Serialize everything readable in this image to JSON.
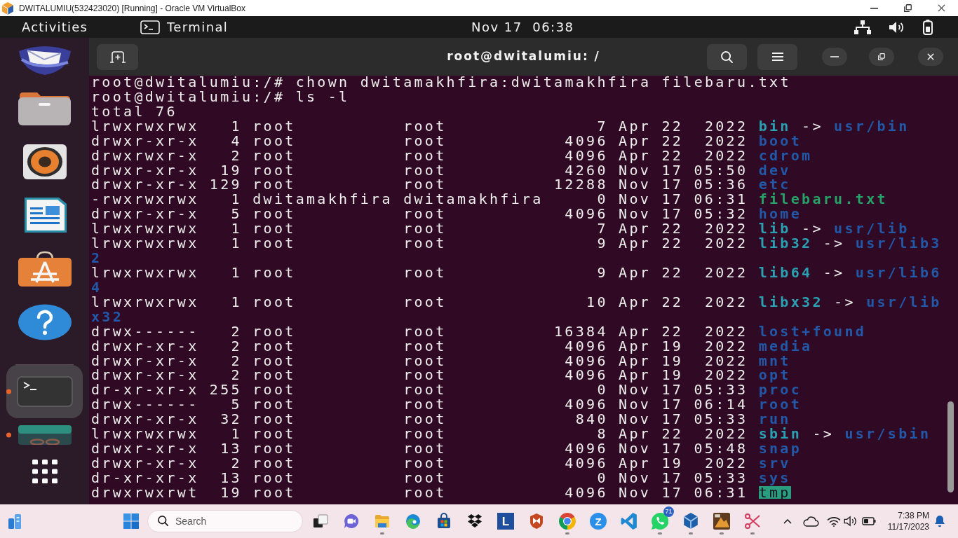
{
  "vm_window": {
    "title": "DWITALUMIU(532423020) [Running] - Oracle VM VirtualBox"
  },
  "top_bar": {
    "activities": "Activities",
    "app_menu": "Terminal",
    "clock": "Nov 17  06:38"
  },
  "dock": {
    "pinned": [
      {
        "kind": "mail",
        "selected": false,
        "running": false
      },
      {
        "kind": "files",
        "selected": false,
        "running": false
      },
      {
        "kind": "music",
        "selected": false,
        "running": false
      },
      {
        "kind": "writer",
        "selected": false,
        "running": false
      },
      {
        "kind": "store",
        "selected": false,
        "running": false
      },
      {
        "kind": "help",
        "selected": false,
        "running": false
      }
    ],
    "others": [
      {
        "kind": "terminal",
        "selected": true,
        "running": true
      },
      {
        "kind": "tile",
        "selected": false,
        "running": true
      }
    ]
  },
  "terminal": {
    "title": "root@dwitalumiu: /",
    "lines": [
      {
        "kind": "command",
        "prompt": "root@dwitalumiu:/#",
        "command": "chown dwitamakhfira:dwitamakhfira filebaru.txt"
      },
      {
        "kind": "command",
        "prompt": "root@dwitalumiu:/#",
        "command": "ls -l"
      },
      {
        "kind": "output",
        "text": "total 76"
      },
      {
        "kind": "entry",
        "mode": "lrwxrwxrwx",
        "links": "1",
        "owner": "root",
        "group": "root",
        "size": "7",
        "month": "Apr",
        "day": "22",
        "time": "2022",
        "name": {
          "text": "bin",
          "kind": "symlink"
        },
        "arrow": "->",
        "target": {
          "text": "usr/bin",
          "kind": "directory"
        }
      },
      {
        "kind": "entry",
        "mode": "drwxr-xr-x",
        "links": "4",
        "owner": "root",
        "group": "root",
        "size": "4096",
        "month": "Apr",
        "day": "22",
        "time": "2022",
        "name": {
          "text": "boot",
          "kind": "directory"
        }
      },
      {
        "kind": "entry",
        "mode": "drwxrwxr-x",
        "links": "2",
        "owner": "root",
        "group": "root",
        "size": "4096",
        "month": "Apr",
        "day": "22",
        "time": "2022",
        "name": {
          "text": "cdrom",
          "kind": "directory"
        }
      },
      {
        "kind": "entry",
        "mode": "drwxr-xr-x",
        "links": "19",
        "owner": "root",
        "group": "root",
        "size": "4260",
        "month": "Nov",
        "day": "17",
        "time": "05:50",
        "name": {
          "text": "dev",
          "kind": "directory"
        }
      },
      {
        "kind": "entry",
        "mode": "drwxr-xr-x",
        "links": "129",
        "owner": "root",
        "group": "root",
        "size": "12288",
        "month": "Nov",
        "day": "17",
        "time": "05:36",
        "name": {
          "text": "etc",
          "kind": "directory"
        }
      },
      {
        "kind": "entry",
        "mode": "-rwxrwxrwx",
        "links": "1",
        "owner": "dwitamakhfira",
        "group": "dwitamakhfira",
        "size": "0",
        "month": "Nov",
        "day": "17",
        "time": "06:31",
        "name": {
          "text": "filebaru.txt",
          "kind": "executable"
        }
      },
      {
        "kind": "entry",
        "mode": "drwxr-xr-x",
        "links": "5",
        "owner": "root",
        "group": "root",
        "size": "4096",
        "month": "Nov",
        "day": "17",
        "time": "05:32",
        "name": {
          "text": "home",
          "kind": "directory"
        }
      },
      {
        "kind": "entry",
        "mode": "lrwxrwxrwx",
        "links": "1",
        "owner": "root",
        "group": "root",
        "size": "7",
        "month": "Apr",
        "day": "22",
        "time": "2022",
        "name": {
          "text": "lib",
          "kind": "symlink"
        },
        "arrow": "->",
        "target": {
          "text": "usr/lib",
          "kind": "directory"
        }
      },
      {
        "kind": "entry",
        "mode": "lrwxrwxrwx",
        "links": "1",
        "owner": "root",
        "group": "root",
        "size": "9",
        "month": "Apr",
        "day": "22",
        "time": "2022",
        "name": {
          "text": "lib32",
          "kind": "symlink"
        },
        "arrow": "->",
        "target": {
          "text": "usr/lib3",
          "kind": "directory"
        }
      },
      {
        "kind": "wrap",
        "segment": {
          "text": "2",
          "kind": "directory"
        }
      },
      {
        "kind": "entry",
        "mode": "lrwxrwxrwx",
        "links": "1",
        "owner": "root",
        "group": "root",
        "size": "9",
        "month": "Apr",
        "day": "22",
        "time": "2022",
        "name": {
          "text": "lib64",
          "kind": "symlink"
        },
        "arrow": "->",
        "target": {
          "text": "usr/lib6",
          "kind": "directory"
        }
      },
      {
        "kind": "wrap",
        "segment": {
          "text": "4",
          "kind": "directory"
        }
      },
      {
        "kind": "entry",
        "mode": "lrwxrwxrwx",
        "links": "1",
        "owner": "root",
        "group": "root",
        "size": "10",
        "month": "Apr",
        "day": "22",
        "time": "2022",
        "name": {
          "text": "libx32",
          "kind": "symlink"
        },
        "arrow": "->",
        "target": {
          "text": "usr/lib",
          "kind": "directory"
        }
      },
      {
        "kind": "wrap",
        "segment": {
          "text": "x32",
          "kind": "directory"
        }
      },
      {
        "kind": "entry",
        "mode": "drwx------",
        "links": "2",
        "owner": "root",
        "group": "root",
        "size": "16384",
        "month": "Apr",
        "day": "22",
        "time": "2022",
        "name": {
          "text": "lost+found",
          "kind": "directory"
        }
      },
      {
        "kind": "entry",
        "mode": "drwxr-xr-x",
        "links": "2",
        "owner": "root",
        "group": "root",
        "size": "4096",
        "month": "Apr",
        "day": "19",
        "time": "2022",
        "name": {
          "text": "media",
          "kind": "directory"
        }
      },
      {
        "kind": "entry",
        "mode": "drwxr-xr-x",
        "links": "2",
        "owner": "root",
        "group": "root",
        "size": "4096",
        "month": "Apr",
        "day": "19",
        "time": "2022",
        "name": {
          "text": "mnt",
          "kind": "directory"
        }
      },
      {
        "kind": "entry",
        "mode": "drwxr-xr-x",
        "links": "2",
        "owner": "root",
        "group": "root",
        "size": "4096",
        "month": "Apr",
        "day": "19",
        "time": "2022",
        "name": {
          "text": "opt",
          "kind": "directory"
        }
      },
      {
        "kind": "entry",
        "mode": "dr-xr-xr-x",
        "links": "255",
        "owner": "root",
        "group": "root",
        "size": "0",
        "month": "Nov",
        "day": "17",
        "time": "05:33",
        "name": {
          "text": "proc",
          "kind": "directory"
        }
      },
      {
        "kind": "entry",
        "mode": "drwx------",
        "links": "5",
        "owner": "root",
        "group": "root",
        "size": "4096",
        "month": "Nov",
        "day": "17",
        "time": "06:14",
        "name": {
          "text": "root",
          "kind": "directory"
        }
      },
      {
        "kind": "entry",
        "mode": "drwxr-xr-x",
        "links": "32",
        "owner": "root",
        "group": "root",
        "size": "840",
        "month": "Nov",
        "day": "17",
        "time": "05:33",
        "name": {
          "text": "run",
          "kind": "directory"
        }
      },
      {
        "kind": "entry",
        "mode": "lrwxrwxrwx",
        "links": "1",
        "owner": "root",
        "group": "root",
        "size": "8",
        "month": "Apr",
        "day": "22",
        "time": "2022",
        "name": {
          "text": "sbin",
          "kind": "symlink"
        },
        "arrow": "->",
        "target": {
          "text": "usr/sbin",
          "kind": "directory"
        }
      },
      {
        "kind": "entry",
        "mode": "drwxr-xr-x",
        "links": "13",
        "owner": "root",
        "group": "root",
        "size": "4096",
        "month": "Nov",
        "day": "17",
        "time": "05:48",
        "name": {
          "text": "snap",
          "kind": "directory"
        }
      },
      {
        "kind": "entry",
        "mode": "drwxr-xr-x",
        "links": "2",
        "owner": "root",
        "group": "root",
        "size": "4096",
        "month": "Apr",
        "day": "19",
        "time": "2022",
        "name": {
          "text": "srv",
          "kind": "directory"
        }
      },
      {
        "kind": "entry",
        "mode": "dr-xr-xr-x",
        "links": "13",
        "owner": "root",
        "group": "root",
        "size": "0",
        "month": "Nov",
        "day": "17",
        "time": "05:33",
        "name": {
          "text": "sys",
          "kind": "directory"
        }
      },
      {
        "kind": "entry",
        "mode": "drwxrwxrwt",
        "links": "19",
        "owner": "root",
        "group": "root",
        "size": "4096",
        "month": "Nov",
        "day": "17",
        "time": "06:31",
        "name": {
          "text": "tmp",
          "kind": "sticky"
        }
      }
    ]
  },
  "taskbar": {
    "search": {
      "placeholder": "Search"
    },
    "apps": [
      {
        "kind": "windowstack",
        "running": false
      },
      {
        "kind": "camera",
        "running": false
      },
      {
        "kind": "folder",
        "running": true
      },
      {
        "kind": "swirl",
        "running": false
      },
      {
        "kind": "bag",
        "running": false
      },
      {
        "kind": "diamonds",
        "running": false
      },
      {
        "kind": "tile",
        "label": "L",
        "running": false
      },
      {
        "kind": "shield",
        "running": false
      },
      {
        "kind": "ring",
        "running": true
      },
      {
        "kind": "disc",
        "label": "Z",
        "running": false
      },
      {
        "kind": "ribbon",
        "running": false
      },
      {
        "kind": "bubble",
        "badge": "71",
        "running": true
      },
      {
        "kind": "cube",
        "running": true
      },
      {
        "kind": "picture",
        "running": true
      },
      {
        "kind": "scissors",
        "running": true
      }
    ],
    "clock": {
      "time": "7:38 PM",
      "date": "11/17/2023"
    }
  }
}
